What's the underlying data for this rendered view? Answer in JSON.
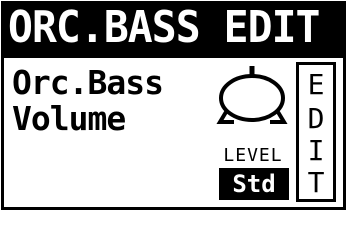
{
  "header": {
    "title": "ORC.BASS EDIT"
  },
  "parameter": {
    "line1": "Orc.Bass",
    "line2": "Volume"
  },
  "control": {
    "icon": "knob-icon",
    "label": "LEVEL",
    "value": "Std"
  },
  "side_tab": {
    "letters": [
      "E",
      "D",
      "I",
      "T"
    ]
  },
  "colors": {
    "foreground": "#000000",
    "background": "#ffffff"
  }
}
